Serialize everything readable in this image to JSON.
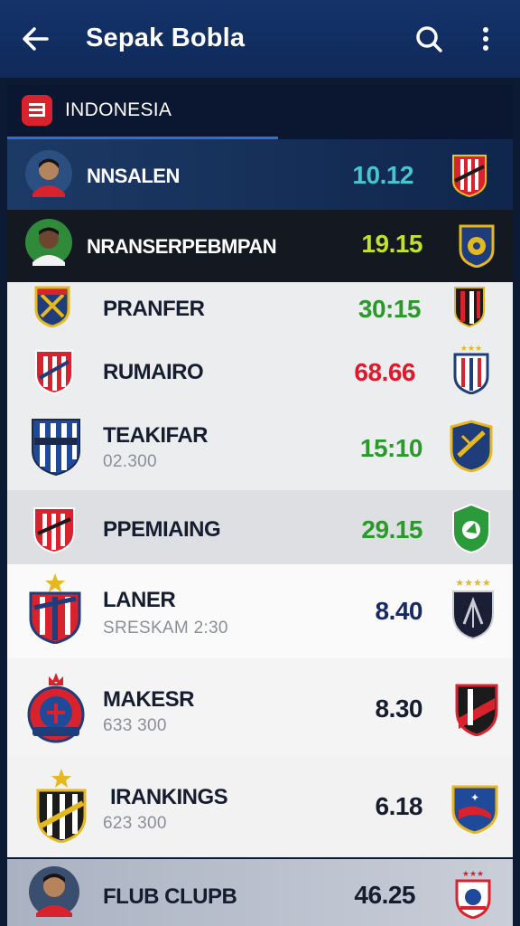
{
  "header": {
    "title": "Sepak Bobla"
  },
  "section": {
    "label": "INDONESIA"
  },
  "rows": [
    {
      "name": "NNSALEN",
      "score": "10.12",
      "score_color": "#46c6d1"
    },
    {
      "name": "NRANSERPEBMPAN",
      "score": "19.15",
      "score_color": "#c3e02b"
    },
    {
      "name": "PRANFER",
      "score": "30:15",
      "score_color": "#2a9a2a"
    },
    {
      "name": "RUMAIRO",
      "score": "68.66",
      "score_color": "#e0182c"
    },
    {
      "name": "TEAKIFAR",
      "sub": "02.300",
      "score": "15:10",
      "score_color": "#2a9a2a"
    },
    {
      "name": "PPEMIAING",
      "score": "29.15",
      "score_color": "#2a9a2a"
    },
    {
      "name": "LANER",
      "sub": "SRESKAM 2:30",
      "score": "8.40",
      "score_color": "#182a66"
    },
    {
      "name": "MAKESR",
      "sub": "633 300",
      "score": "8.30",
      "score_color": "#151d2e"
    },
    {
      "name": "IRANKINGS",
      "sub": "623 300",
      "score": "6.18",
      "score_color": "#151d2e"
    },
    {
      "name": "FLUB CLUPB",
      "score": "46.25",
      "score_color": "#151d2e"
    }
  ]
}
